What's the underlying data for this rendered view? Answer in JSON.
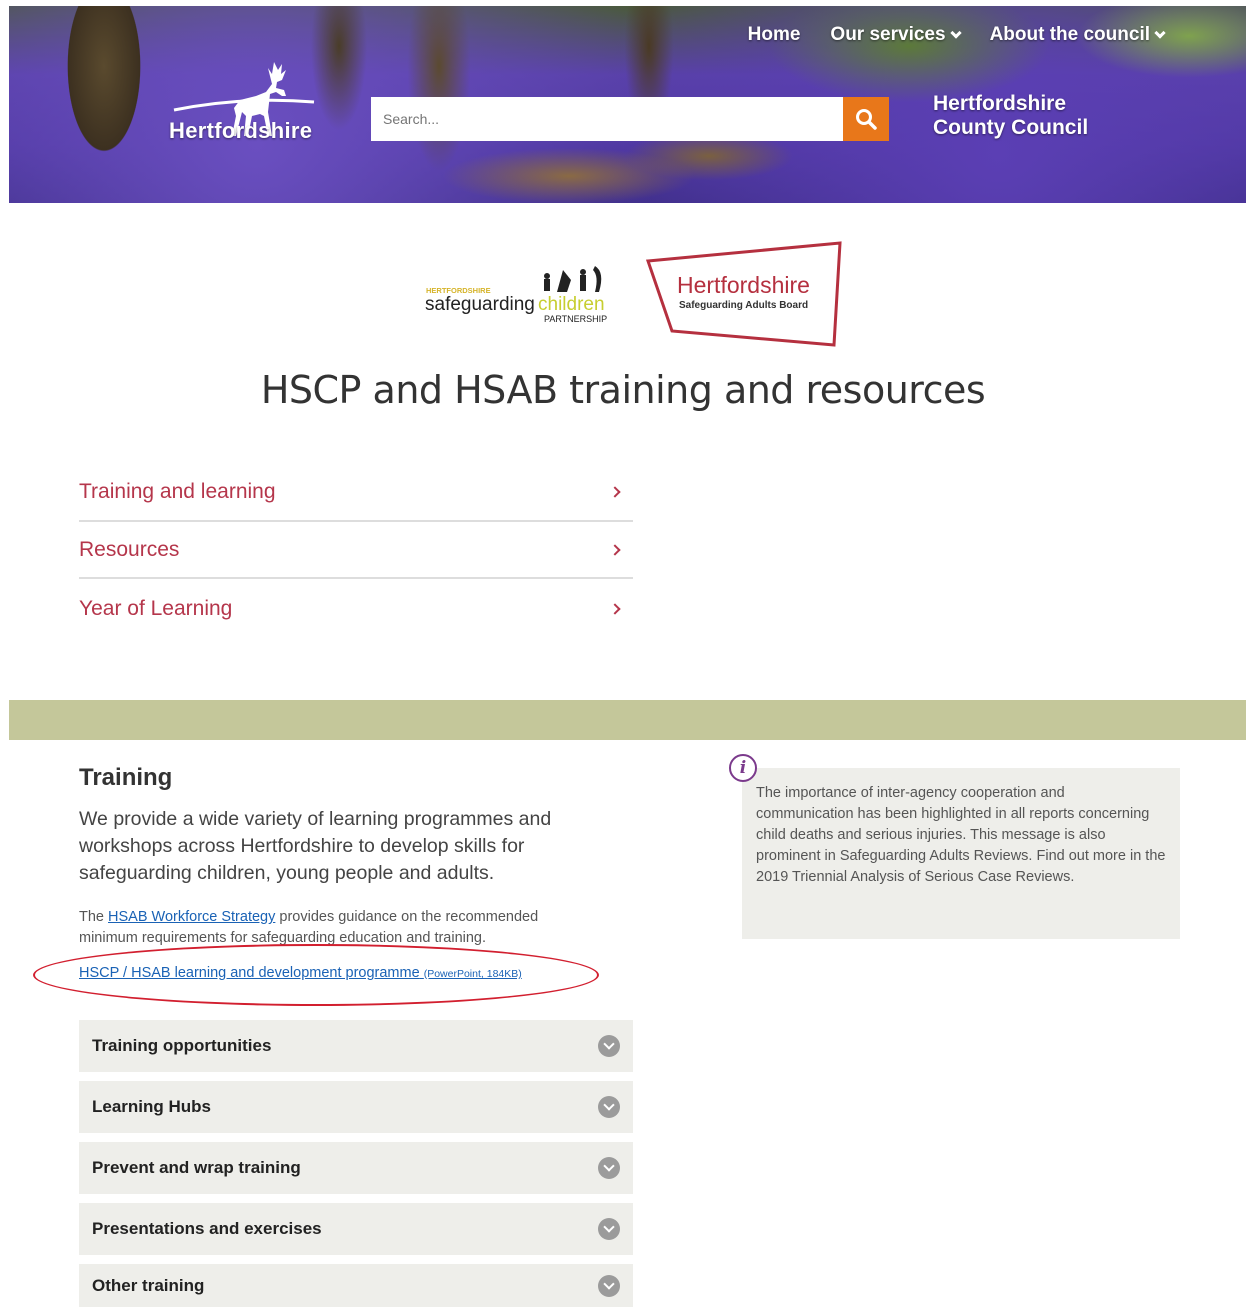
{
  "header": {
    "nav": [
      {
        "label": "Home",
        "has_dropdown": false
      },
      {
        "label": "Our services",
        "has_dropdown": true
      },
      {
        "label": "About the council",
        "has_dropdown": true
      }
    ],
    "logo_text": "Hertfordshire",
    "search_placeholder": "Search...",
    "council_name_line1": "Hertfordshire",
    "council_name_line2": "County Council"
  },
  "partners": {
    "hscp_small": "HERTFORDSHIRE",
    "hscp_main1": "safeguarding",
    "hscp_main2": "children",
    "hscp_sub": "PARTNERSHIP",
    "hsab_title": "Hertfordshire",
    "hsab_sub": "Safeguarding Adults Board"
  },
  "page_title": "HSCP and HSAB training and resources",
  "nav_list": [
    {
      "label": "Training and learning"
    },
    {
      "label": "Resources"
    },
    {
      "label": "Year of Learning"
    }
  ],
  "training": {
    "title": "Training",
    "intro": "We provide a wide variety of learning programmes and workshops across Hertfordshire to develop skills for safeguarding children, young people and adults.",
    "note_prefix": "The ",
    "note_link": "HSAB Workforce Strategy",
    "note_suffix": " provides guidance on the recommended minimum requirements for safeguarding education and training.",
    "download_link": "HSCP / HSAB learning and development programme",
    "download_meta": "(PowerPoint, 184KB)"
  },
  "accordions": [
    {
      "label": "Training opportunities"
    },
    {
      "label": "Learning Hubs"
    },
    {
      "label": "Prevent and wrap training"
    },
    {
      "label": "Presentations and exercises"
    },
    {
      "label": "Other training"
    }
  ],
  "info_box": {
    "icon": "info-icon",
    "text": "The importance of inter-agency cooperation and communication has been highlighted in all reports concerning child deaths and serious injuries. This message is also prominent in Safeguarding Adults Reviews. Find out more in the 2019 Triennial Analysis of Serious Case Reviews."
  },
  "colors": {
    "accent_orange": "#e8771a",
    "link_red": "#b5364b",
    "band_green": "#c4c79a",
    "highlight_ellipse": "#d21f2f",
    "info_purple": "#7b3a8c"
  }
}
